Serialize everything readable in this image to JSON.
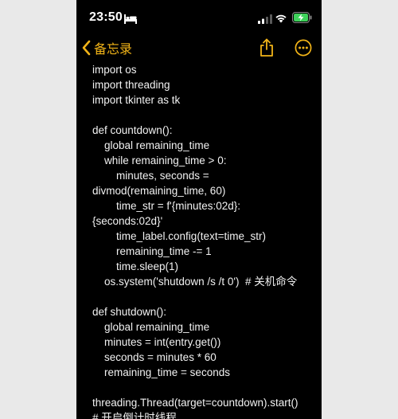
{
  "status_bar": {
    "time": "23:50",
    "icons": [
      "bed-icon",
      "signal-icon",
      "wifi-icon",
      "battery-charging-icon"
    ]
  },
  "nav": {
    "back_label": "备忘录",
    "accent_color": "#f2b418",
    "icons": [
      "chevron-left-icon",
      "share-icon",
      "more-icon"
    ]
  },
  "note": {
    "lines": [
      "import os",
      "import threading",
      "import tkinter as tk",
      "",
      "def countdown():",
      "    global remaining_time",
      "    while remaining_time > 0:",
      "        minutes, seconds =",
      "divmod(remaining_time, 60)",
      "        time_str = f'{minutes:02d}:",
      "{seconds:02d}'",
      "        time_label.config(text=time_str)",
      "        remaining_time -= 1",
      "        time.sleep(1)",
      "    os.system('shutdown /s /t 0')  # 关机命令",
      "",
      "def shutdown():",
      "    global remaining_time",
      "    minutes = int(entry.get())",
      "    seconds = minutes * 60",
      "    remaining_time = seconds",
      "",
      "threading.Thread(target=countdown).start()",
      "# 开启倒计时线程"
    ]
  }
}
